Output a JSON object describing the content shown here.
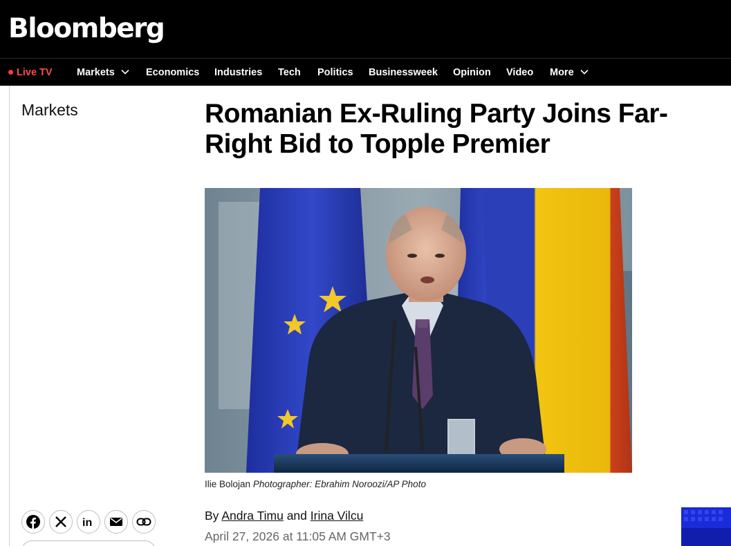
{
  "brand": {
    "logo_text": "Bloomberg"
  },
  "nav": {
    "live_tv": "Live TV",
    "items": [
      "Markets",
      "Economics",
      "Industries",
      "Tech",
      "Politics",
      "Businessweek",
      "Opinion",
      "Video",
      "More"
    ],
    "dropdown_items": [
      "Markets",
      "More"
    ]
  },
  "article": {
    "section": "Markets",
    "headline_line1": "Romanian Ex-Ruling Party Joins Far-",
    "headline_line2": "Right Bid to Topple Premier",
    "photo_alt": "Ilie Bolojan speaking at a podium in front of EU and Romanian flags",
    "caption_subject": "Ilie Bolojan",
    "caption_credit": "Photographer: Ebrahim Noroozi/AP Photo",
    "byline_prefix": "By",
    "author1": "Andra Timu",
    "byline_and": "and",
    "author2": "Irina Vilcu",
    "date": "April 27, 2026 at 11:05 AM GMT+3"
  },
  "share": {
    "buttons": [
      "facebook-icon",
      "x-icon",
      "linkedin-icon",
      "email-icon",
      "link-icon"
    ]
  },
  "colors": {
    "header_bg": "#000000",
    "live_tv": "#ff4b4b",
    "text": "#111111",
    "date_text": "#666666",
    "eu_blue": "#2a3fb8",
    "eu_star": "#f2c72a",
    "romania_yellow": "#f3c410",
    "ad_blue": "#1a2bd9"
  }
}
